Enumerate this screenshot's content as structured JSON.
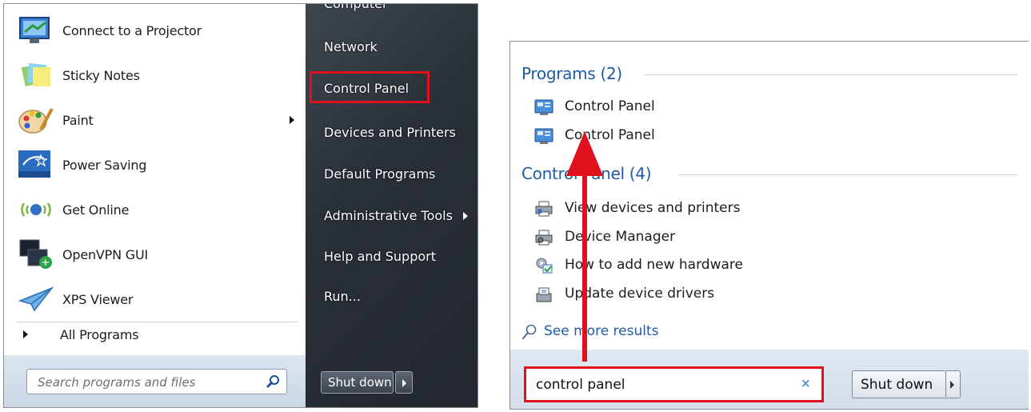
{
  "start_menu": {
    "programs": [
      {
        "label": "Connect to a Projector",
        "icon": "projector-icon",
        "has_submenu": false
      },
      {
        "label": "Sticky Notes",
        "icon": "sticky-notes-icon",
        "has_submenu": false
      },
      {
        "label": "Paint",
        "icon": "paint-palette-icon",
        "has_submenu": true
      },
      {
        "label": "Power Saving",
        "icon": "energy-star-icon",
        "has_submenu": false
      },
      {
        "label": "Get Online",
        "icon": "get-online-icon",
        "has_submenu": false
      },
      {
        "label": "OpenVPN GUI",
        "icon": "openvpn-icon",
        "has_submenu": false
      },
      {
        "label": "XPS Viewer",
        "icon": "xps-viewer-icon",
        "has_submenu": false
      }
    ],
    "all_programs_label": "All Programs",
    "search_placeholder": "Search programs and files",
    "places": [
      {
        "label": "Computer",
        "has_submenu": false
      },
      {
        "label": "Network",
        "has_submenu": false
      },
      {
        "label": "Control Panel",
        "has_submenu": false,
        "highlighted": true
      },
      {
        "label": "Devices and Printers",
        "has_submenu": false
      },
      {
        "label": "Default Programs",
        "has_submenu": false
      },
      {
        "label": "Administrative Tools",
        "has_submenu": true
      },
      {
        "label": "Help and Support",
        "has_submenu": false
      },
      {
        "label": "Run...",
        "has_submenu": false
      }
    ],
    "shutdown_label": "Shut down"
  },
  "search_results": {
    "groups": [
      {
        "title": "Programs (2)",
        "items": [
          {
            "label": "Control Panel",
            "icon": "control-panel-icon"
          },
          {
            "label": "Control Panel",
            "icon": "control-panel-icon"
          }
        ]
      },
      {
        "title": "Control Panel (4)",
        "items": [
          {
            "label": "View devices and printers",
            "icon": "printer-icon"
          },
          {
            "label": "Device Manager",
            "icon": "device-manager-icon"
          },
          {
            "label": "How to add new hardware",
            "icon": "hardware-icon"
          },
          {
            "label": "Update device drivers",
            "icon": "driver-update-icon"
          }
        ]
      }
    ],
    "see_more_label": "See more results",
    "search_value": "control panel",
    "clear_icon": "×",
    "shutdown_label": "Shut down"
  },
  "colors": {
    "highlight_red": "#e0101c",
    "link_blue": "#1e5aa8",
    "menu_dark": "#2a3038"
  }
}
